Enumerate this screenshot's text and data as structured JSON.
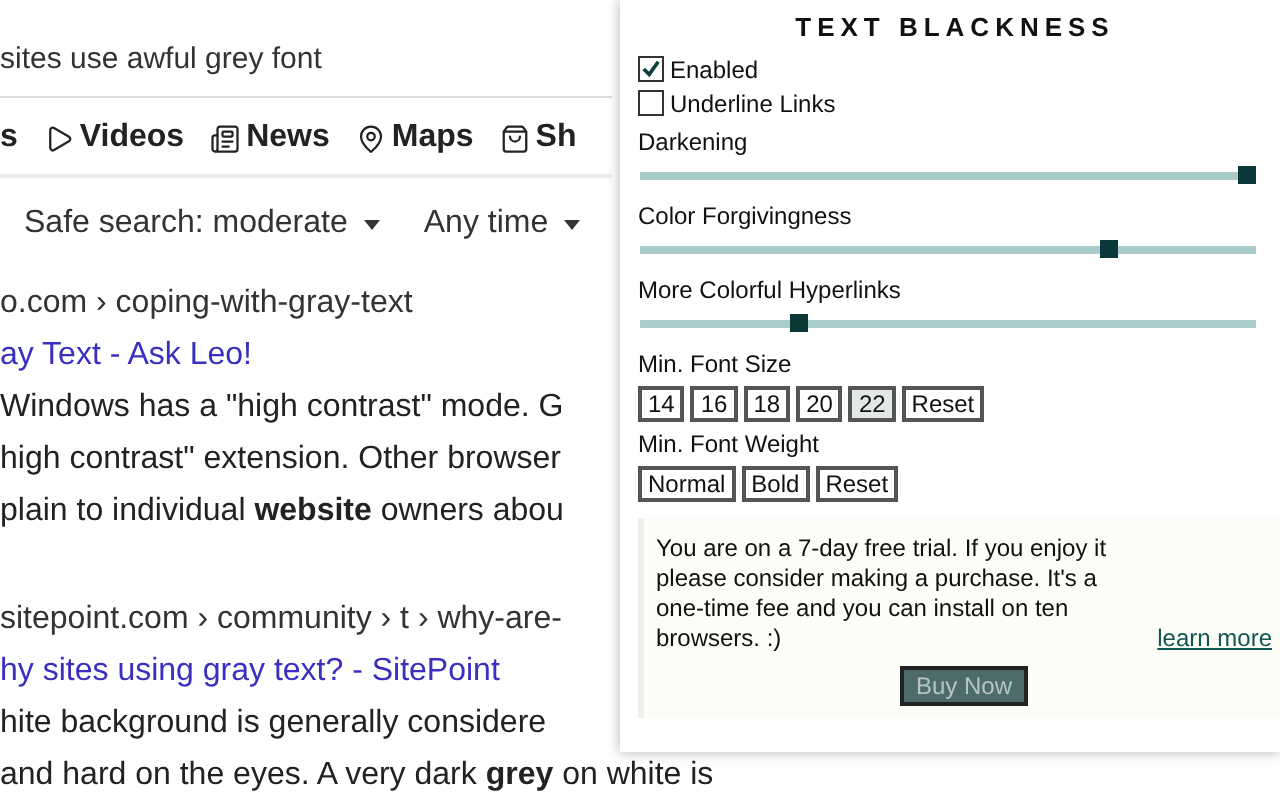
{
  "search": {
    "query": "sites use awful grey font"
  },
  "nav_tabs": [
    {
      "label": "s",
      "kind": "none"
    },
    {
      "label": "Videos",
      "kind": "videos"
    },
    {
      "label": "News",
      "kind": "news"
    },
    {
      "label": "Maps",
      "kind": "maps"
    },
    {
      "label": "Sh",
      "kind": "shopping"
    }
  ],
  "filters": [
    {
      "label": "Safe search: moderate"
    },
    {
      "label": "Any time"
    }
  ],
  "results": [
    {
      "url": "o.com › coping-with-gray-text",
      "title": "ay Text - Ask Leo!",
      "snippet": [
        "Windows has a \"high contrast\" mode. G",
        "high contrast\" extension. Other browser",
        "plain to individual **website** owners abou"
      ]
    },
    {
      "url": "sitepoint.com › community › t › why-are-",
      "title": "hy sites using gray text? - SitePoint",
      "snippet": [
        "hite background is generally considere",
        "and hard on the eyes. A very dark **grey** on white is"
      ]
    }
  ],
  "popup": {
    "title": "TEXT BLACKNESS",
    "checkboxes": [
      {
        "label": "Enabled",
        "checked": true
      },
      {
        "label": "Underline Links",
        "checked": false
      }
    ],
    "sliders": [
      {
        "label": "Darkening",
        "level": 1.0
      },
      {
        "label": "Color Forgivingness",
        "level": 0.77
      },
      {
        "label": "More Colorful Hyperlinks",
        "level": 0.25
      }
    ],
    "font_size": {
      "label": "Min. Font Size",
      "options": [
        {
          "label": "14",
          "selected": false
        },
        {
          "label": "16",
          "selected": false
        },
        {
          "label": "18",
          "selected": false
        },
        {
          "label": "20",
          "selected": false
        },
        {
          "label": "22",
          "selected": true
        }
      ],
      "reset": "Reset"
    },
    "font_weight": {
      "label": "Min. Font Weight",
      "options": [
        {
          "label": "Normal",
          "selected": false
        },
        {
          "label": "Bold",
          "selected": false
        }
      ],
      "reset": "Reset"
    },
    "trial": {
      "message": "You are on a 7-day free trial. If you enjoy it please consider making a purchase. It's a one-time fee and you can install on ten browsers. :)",
      "link": "learn more"
    },
    "buy_button": "Buy Now"
  }
}
